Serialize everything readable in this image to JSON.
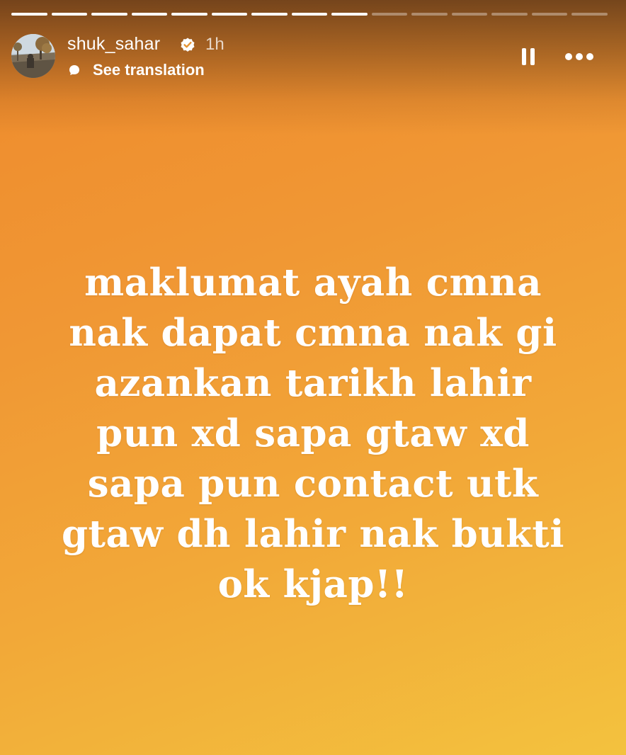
{
  "story": {
    "progress": {
      "total_segments": 15,
      "completed_segments": 9
    },
    "header": {
      "username": "shuk_sahar",
      "verified": true,
      "time_ago": "1h",
      "translation_label": "See translation",
      "icons": {
        "verified": "verified-badge-icon",
        "translation": "speech-bubble-icon",
        "pause": "pause-icon",
        "more": "more-options-icon"
      }
    },
    "text_lines": [
      "maklumat ayah cmna",
      "nak dapat cmna nak gi",
      "azankan tarikh lahir",
      "pun xd sapa gtaw xd",
      "sapa pun contact utk",
      "gtaw dh lahir nak bukti",
      "ok kjap!!"
    ],
    "colors": {
      "gradient_start": "#ee8a2c",
      "gradient_end": "#f3c23e",
      "text": "#ffffff"
    }
  }
}
